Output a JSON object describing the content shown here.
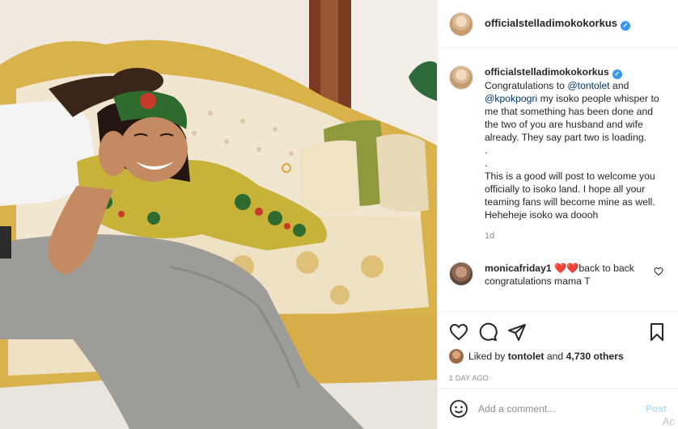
{
  "post": {
    "author": "officialstelladimokokorkus",
    "verified_mark": "✓",
    "photo_alt": "Photo"
  },
  "caption": {
    "author": "officialstelladimokokorkus",
    "segments": {
      "intro": "Congratulations to ",
      "mention1": "@tontolet",
      "and": " and ",
      "mention2": "@kpokpogri",
      "rest": " my isoko people whisper to me that something has been done and the two of you are husband and wife already. They say part two is loading.\n.\n.\nThis is a good will post to welcome you officially to isoko land. I hope all your teaming fans will become mine as well. Heheheje isoko wa doooh"
    },
    "time": "1d"
  },
  "comments": [
    {
      "author": "monicafriday1",
      "text_emoji": "❤️❤️",
      "text": "back to back congratulations mama T"
    }
  ],
  "actions": {
    "like_icon": "heart-icon",
    "comment_icon": "comment-icon",
    "share_icon": "paper-plane-icon",
    "save_icon": "bookmark-icon"
  },
  "likes": {
    "prefix": "Liked by ",
    "user": "tontolet",
    "middle": " and ",
    "count": "4,730 others"
  },
  "date": "1 DAY AGO",
  "composer": {
    "placeholder": "Add a comment...",
    "post_label": "Post",
    "emoji_icon": "smiley-icon"
  },
  "watermark": "Ac",
  "colors": {
    "verified": "#3897f0",
    "mention": "#00376b",
    "heart": "#ed4956",
    "post_disabled": "#b2dffc"
  }
}
